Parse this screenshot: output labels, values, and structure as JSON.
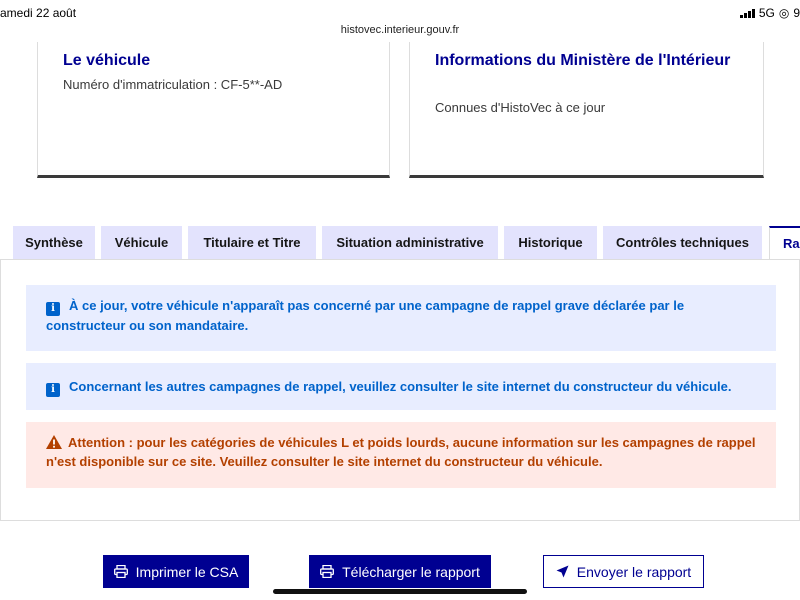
{
  "status_bar": {
    "time": "amedi 22 août",
    "network": "5G",
    "battery": "9"
  },
  "browser": {
    "url": "histovec.interieur.gouv.fr"
  },
  "cards": {
    "vehicle": {
      "title": "Le véhicule",
      "subtitle": "Numéro d'immatriculation : CF-5**-AD"
    },
    "ministry": {
      "title": "Informations du Ministère de l'Intérieur",
      "subtitle": "Connues d'HistoVec à ce jour"
    }
  },
  "tabs": [
    {
      "label": "Synthèse"
    },
    {
      "label": "Véhicule"
    },
    {
      "label": "Titulaire et Titre"
    },
    {
      "label": "Situation administrative"
    },
    {
      "label": "Historique"
    },
    {
      "label": "Contrôles techniques"
    },
    {
      "label": "Rappels",
      "active": true
    }
  ],
  "alerts": [
    {
      "type": "info",
      "icon": "info-icon",
      "text": "À ce jour, votre véhicule n'apparaît pas concerné par une campagne de rappel grave déclarée par le constructeur ou son mandataire."
    },
    {
      "type": "info",
      "icon": "info-icon",
      "text": "Concernant les autres campagnes de rappel, veuillez consulter le site internet du constructeur du véhicule."
    },
    {
      "type": "warning",
      "icon": "warning-icon",
      "text": "Attention : pour les catégories de véhicules L et poids lourds, aucune information sur les campagnes de rappel n'est disponible sur ce site. Veuillez consulter le site internet du constructeur du véhicule."
    }
  ],
  "actions": {
    "print_label": "Imprimer le CSA",
    "download_label": "Télécharger le rapport",
    "send_label": "Envoyer le rapport"
  },
  "colors": {
    "primary": "#000091",
    "info_bg": "#e8edff",
    "info_text": "#0063cb",
    "warning_bg": "#ffe9e6",
    "warning_text": "#b34000",
    "tab_bg": "#e3e3fd"
  }
}
